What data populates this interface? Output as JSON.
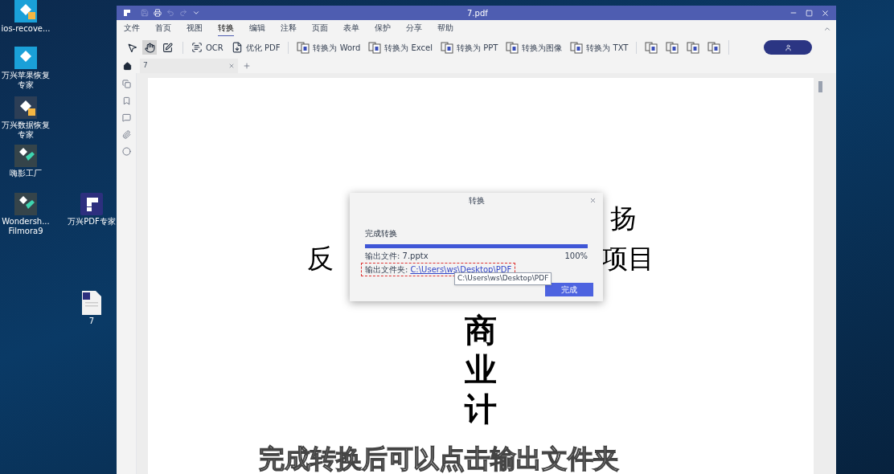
{
  "desktop": {
    "icons": [
      {
        "label": "ios-recove...",
        "kind": "recovery"
      },
      {
        "label": "万兴苹果恢复专家",
        "kind": "apple_recovery"
      },
      {
        "label": "万兴数据恢复专家",
        "kind": "data_recovery"
      },
      {
        "label": "嗨影工厂",
        "kind": "video"
      },
      {
        "label": "Wondersh... Filmora9",
        "kind": "video"
      },
      {
        "label": "万兴PDF专家",
        "kind": "pdf"
      },
      {
        "label": "7",
        "kind": "file"
      }
    ]
  },
  "window": {
    "title": "7.pdf",
    "quick_access": [
      {
        "kind": "save",
        "disabled": true
      },
      {
        "kind": "print",
        "disabled": false
      },
      {
        "kind": "undo",
        "disabled": true
      },
      {
        "kind": "redo",
        "disabled": true
      },
      {
        "kind": "more",
        "disabled": false
      }
    ],
    "menu": [
      {
        "label": "文件",
        "selected": false
      },
      {
        "label": "首页",
        "selected": false
      },
      {
        "label": "视图",
        "selected": false
      },
      {
        "label": "转换",
        "selected": true
      },
      {
        "label": "编辑",
        "selected": false
      },
      {
        "label": "注释",
        "selected": false
      },
      {
        "label": "页面",
        "selected": false
      },
      {
        "label": "表单",
        "selected": false
      },
      {
        "label": "保护",
        "selected": false
      },
      {
        "label": "分享",
        "selected": false
      },
      {
        "label": "帮助",
        "selected": false
      }
    ],
    "tools": [
      {
        "kind": "select",
        "selected": false
      },
      {
        "kind": "hand",
        "selected": true
      },
      {
        "kind": "edit",
        "selected": false
      }
    ],
    "toolbar_groups": [
      [
        {
          "label": "OCR",
          "kind": "ocr"
        },
        {
          "label": "优化 PDF",
          "kind": "optimize"
        }
      ],
      [
        {
          "label": "转换为 Word",
          "kind": "word"
        },
        {
          "label": "转换为 Excel",
          "kind": "excel"
        },
        {
          "label": "转换为 PPT",
          "kind": "ppt"
        },
        {
          "label": "转换为图像",
          "kind": "image"
        },
        {
          "label": "转换为 TXT",
          "kind": "txt"
        }
      ],
      [
        {
          "kind": "e"
        },
        {
          "kind": "h"
        },
        {
          "kind": "r"
        },
        {
          "kind": "p"
        }
      ]
    ],
    "tabs": [
      {
        "label": "7",
        "selected": true
      }
    ],
    "document": {
      "line_1": "扬",
      "line_2_left": "反",
      "line_2_right": "项目",
      "vertical_title": [
        "商",
        "业",
        "计"
      ]
    }
  },
  "dialog": {
    "title": "转换",
    "status": "完成转换",
    "level": 1,
    "output_file": "输出文件: 7.pptx",
    "percent": "100%",
    "folder_label": "输出文件夹:",
    "folder_link": "C:\\Users\\ws\\Desktop\\PDF",
    "tooltip": "C:\\Users\\ws\\Desktop\\PDF",
    "button": "完成"
  },
  "subtitle": "完成转换后可以点击输出文件夹"
}
